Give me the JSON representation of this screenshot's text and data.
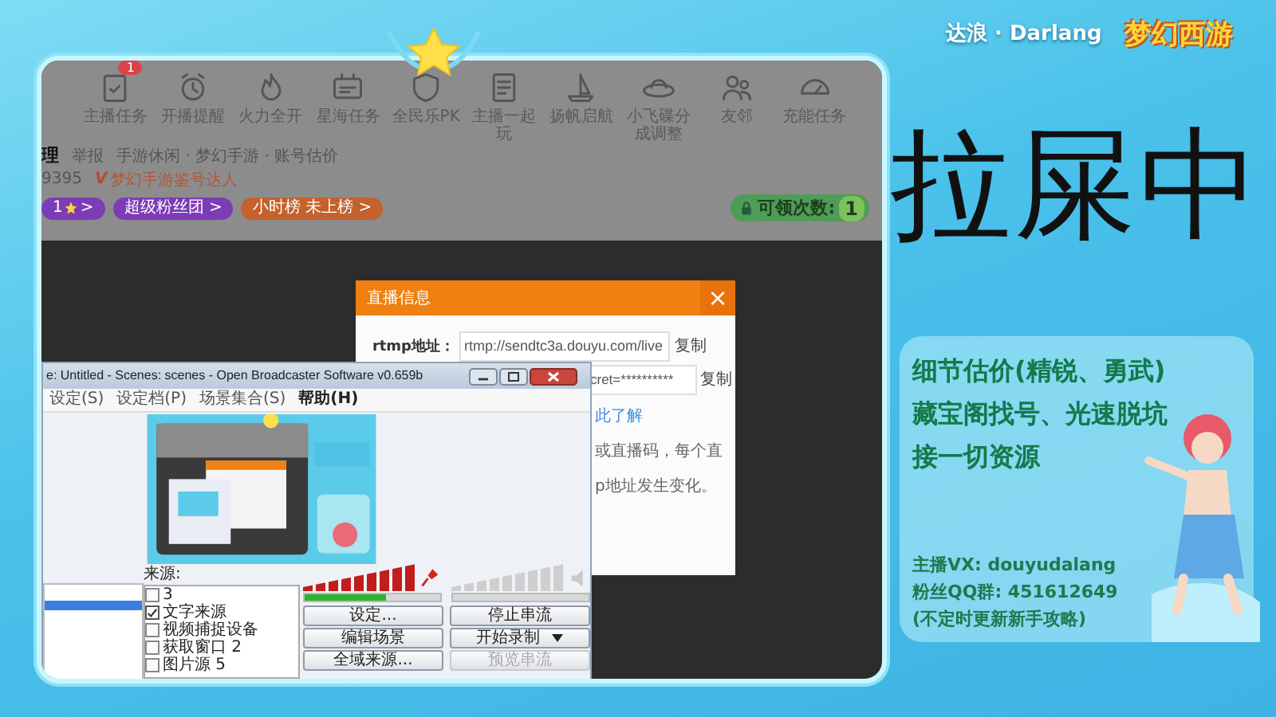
{
  "overlay": {
    "streamer": "达浪 · Darlang",
    "game_logo": "梦幻西游",
    "status_text": "拉屎中",
    "promo": [
      "细节估价(精锐、勇武)",
      "藏宝阁找号、光速脱坑",
      "接一切资源"
    ],
    "contacts": [
      "主播VX: douyudalang",
      "粉丝QQ群: 451612649",
      "(不定时更新新手攻略)"
    ]
  },
  "toolbar": [
    {
      "label": "主播任务",
      "badge": "1"
    },
    {
      "label": "开播提醒"
    },
    {
      "label": "火力全开"
    },
    {
      "label": "星海任务"
    },
    {
      "label": "全民乐PK"
    },
    {
      "label": "主播一起玩"
    },
    {
      "label": "扬帆启航"
    },
    {
      "label": "小飞碟分成调整"
    },
    {
      "label": "友邻"
    },
    {
      "label": "充能任务"
    }
  ],
  "room": {
    "title": "理",
    "report": "举报",
    "category": "手游休闲 · 梦幻手游 · 账号估价",
    "room_id": "9395",
    "verify_mark": "V",
    "verified": "梦幻手游鉴号达人",
    "tags": [
      {
        "label": "1",
        "star": true,
        "arrow": ">",
        "color": "#7d3cb5"
      },
      {
        "label": "超级粉丝团",
        "star": false,
        "arrow": ">",
        "color": "#7d3cb5"
      },
      {
        "label": "小时榜 未上榜",
        "star": false,
        "arrow": ">",
        "color": "#c4612c"
      }
    ],
    "claim": {
      "label": "可领次数:",
      "count": "1"
    }
  },
  "dialog": {
    "title": "直播信息",
    "close": "×",
    "rows": [
      {
        "label": "rtmp地址：",
        "value": "rtmp://sendtc3a.douyu.com/live",
        "action": "复制"
      },
      {
        "value": "cret=**********",
        "action": "复制"
      }
    ],
    "link": "此了解",
    "notes": [
      "或直播码，每个直",
      "p地址发生变化。"
    ]
  },
  "obs": {
    "title": "e: Untitled - Scenes: scenes - Open Broadcaster Software v0.659b",
    "menu": [
      "设定(S)",
      "设定档(P)",
      "场景集合(S)",
      "帮助(H)"
    ],
    "sources_label": "来源:",
    "sources": [
      {
        "label": "3",
        "checked": false
      },
      {
        "label": "文字来源",
        "checked": true
      },
      {
        "label": "视频捕捉设备",
        "checked": false
      },
      {
        "label": "获取窗口 2",
        "checked": false
      },
      {
        "label": "图片源 5",
        "checked": false
      }
    ],
    "channels": [
      {
        "kind": "mic",
        "meter": {
          "level": 1
        },
        "slider": {
          "level": 0.6
        }
      },
      {
        "kind": "speaker",
        "meter": {
          "level": 0
        },
        "slider": {
          "level": 0
        }
      }
    ],
    "buttons": [
      {
        "label": "设定...",
        "disabled": false,
        "dropdown": false
      },
      {
        "label": "停止串流",
        "disabled": false,
        "dropdown": false
      },
      {
        "label": "编辑场景",
        "disabled": false,
        "dropdown": false
      },
      {
        "label": "开始录制",
        "disabled": false,
        "dropdown": true
      },
      {
        "label": "全域来源...",
        "disabled": false,
        "dropdown": false
      },
      {
        "label": "预览串流",
        "disabled": true,
        "dropdown": false
      }
    ]
  }
}
